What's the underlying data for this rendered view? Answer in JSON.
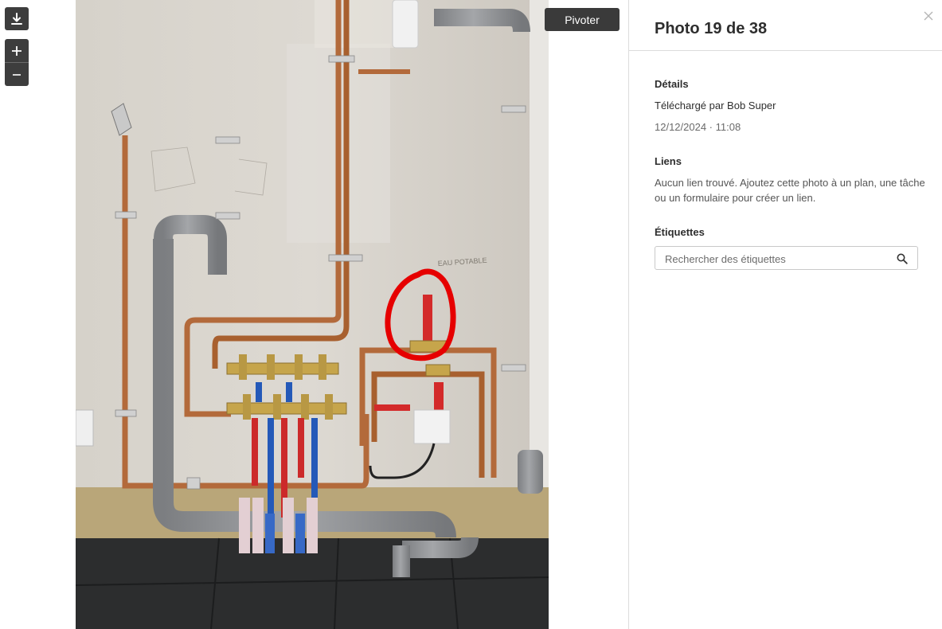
{
  "toolbar": {
    "download_icon": "download-icon",
    "zoom_in_icon": "plus-icon",
    "zoom_out_icon": "minus-icon",
    "pivot_label": "Pivoter"
  },
  "photo": {
    "wall_text_1": "EAU POTABLE"
  },
  "panel": {
    "title": "Photo 19 de 38",
    "close_icon": "close-icon",
    "details": {
      "heading": "Détails",
      "uploaded_by": "Téléchargé par Bob Super",
      "date": "12/12/2024 · 11:08"
    },
    "links": {
      "heading": "Liens",
      "text": "Aucun lien trouvé. Ajoutez cette photo à un plan, une tâche ou un formulaire pour créer un lien."
    },
    "tags": {
      "heading": "Étiquettes",
      "search_placeholder": "Rechercher des étiquettes",
      "search_icon": "search-icon"
    }
  },
  "colors": {
    "button_dark": "#3d3d3d",
    "highlight_circle": "#e60000",
    "copper": "#b36a3b",
    "pvc": "#8f9194"
  }
}
